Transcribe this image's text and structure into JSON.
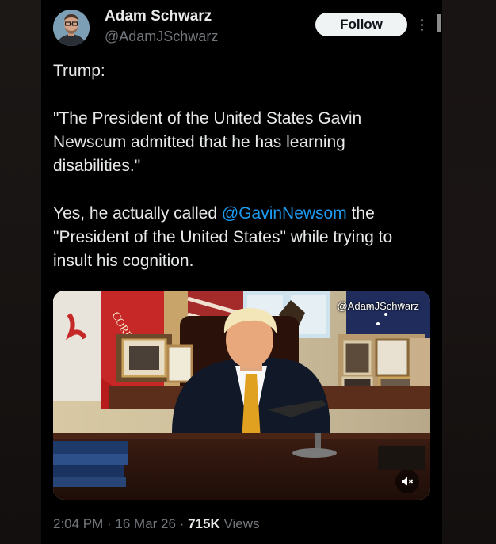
{
  "author": {
    "display_name": "Adam Schwarz",
    "handle": "@AdamJSchwarz",
    "follow_label": "Follow"
  },
  "tweet": {
    "line1": "Trump:",
    "quote": "\"The President of the United States Gavin Newscum admitted that he has learning disabilities.\"",
    "comment_before": "Yes, he actually called ",
    "mention": "@GavinNewsom",
    "comment_after": " the \"President of the United States\" while trying to insult his cognition."
  },
  "media": {
    "watermark": "@AdamJSchwarz",
    "icons": {
      "mute": "muted-speaker-icon"
    }
  },
  "meta": {
    "time": "2:04 PM",
    "sep1": " · ",
    "date": "16 Mar 26",
    "sep2": " · ",
    "views_count": "715K",
    "views_label": " Views"
  },
  "colors": {
    "background": "#000000",
    "text": "#e7e9ea",
    "secondary": "#71767b",
    "link": "#1d9bf0",
    "follow_bg": "#eff3f4"
  }
}
